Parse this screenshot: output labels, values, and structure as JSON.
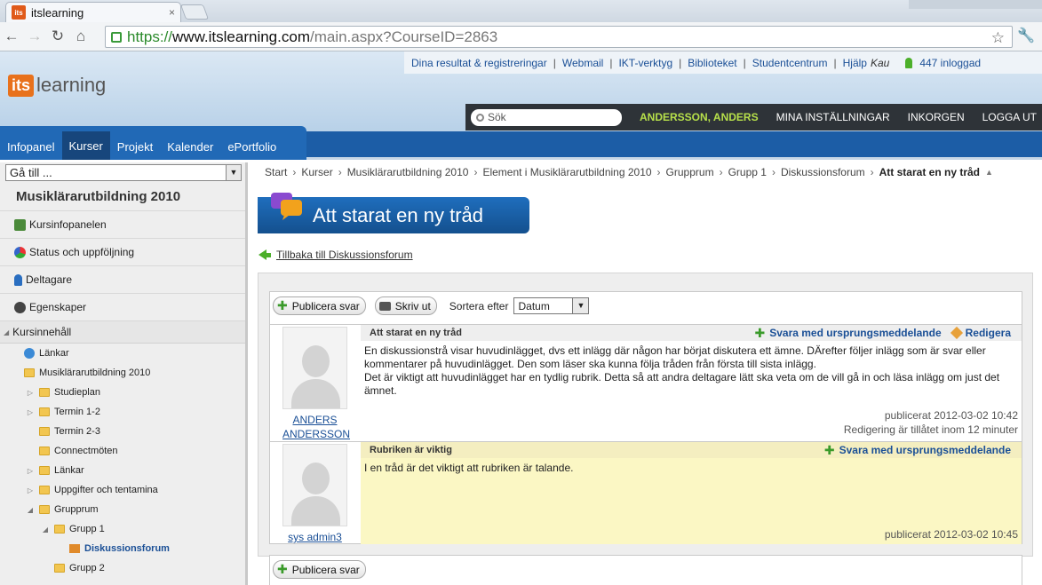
{
  "browser": {
    "tab_title": "itslearning",
    "tab_icon_text": "its",
    "tab_close": "×",
    "url_scheme": "https://",
    "url_host": "www.itslearning.com",
    "url_path": "/main.aspx?CourseID=2863"
  },
  "site": {
    "logo_its": "its",
    "logo_learning": "learning",
    "top_links": [
      "Dina resultat & registreringar",
      "Webmail",
      "IKT-verktyg",
      "Biblioteket",
      "Studentcentrum",
      "Hjälp"
    ],
    "separator": "|",
    "institution": "Kau",
    "online_count": "447 inloggad",
    "search_placeholder": "Sök",
    "user_name": "ANDERSSON, ANDERS",
    "settings_label": "MINA INSTÄLLNINGAR",
    "inbox_label": "INKORGEN",
    "logout_label": "LOGGA UT"
  },
  "nav": {
    "items": [
      "Infopanel",
      "Kurser",
      "Projekt",
      "Kalender",
      "ePortfolio"
    ],
    "active": "Kurser"
  },
  "sidebar": {
    "goto": "Gå till ...",
    "course_title": "Musiklärarutbildning 2010",
    "items": [
      {
        "label": "Kursinfopanelen",
        "icon": "info-board-icon"
      },
      {
        "label": "Status och uppföljning",
        "icon": "pie-chart-icon"
      },
      {
        "label": "Deltagare",
        "icon": "person-icon"
      },
      {
        "label": "Egenskaper",
        "icon": "gear-icon"
      }
    ],
    "content_header": "Kursinnehåll",
    "tree": [
      {
        "label": "Länkar",
        "indent": 0,
        "icon": "globe",
        "toggle": ""
      },
      {
        "label": "Musiklärarutbildning 2010",
        "indent": 0,
        "icon": "folder",
        "toggle": ""
      },
      {
        "label": "Studieplan",
        "indent": 1,
        "icon": "folder",
        "toggle": "▷"
      },
      {
        "label": "Termin 1-2",
        "indent": 1,
        "icon": "folder",
        "toggle": "▷"
      },
      {
        "label": "Termin 2-3",
        "indent": 1,
        "icon": "folder",
        "toggle": ""
      },
      {
        "label": "Connectmöten",
        "indent": 1,
        "icon": "folder",
        "toggle": ""
      },
      {
        "label": "Länkar",
        "indent": 1,
        "icon": "folder",
        "toggle": "▷"
      },
      {
        "label": "Uppgifter och tentamina",
        "indent": 1,
        "icon": "folder",
        "toggle": "▷"
      },
      {
        "label": "Grupprum",
        "indent": 1,
        "icon": "folder",
        "toggle": "◢"
      },
      {
        "label": "Grupp 1",
        "indent": 2,
        "icon": "folder",
        "toggle": "◢"
      },
      {
        "label": "Diskussionsforum",
        "indent": 3,
        "icon": "forum",
        "toggle": "",
        "current": true
      },
      {
        "label": "Grupp 2",
        "indent": 2,
        "icon": "folder",
        "toggle": ""
      }
    ]
  },
  "breadcrumb": [
    "Start",
    "Kurser",
    "Musiklärarutbildning 2010",
    "Element i Musiklärarutbildning 2010",
    "Grupprum",
    "Grupp 1",
    "Diskussionsforum",
    "Att starat en ny tråd"
  ],
  "breadcrumb_sep": "›",
  "page": {
    "title": "Att starat en ny tråd",
    "back_link": "Tillbaka till Diskussionsforum",
    "publish_label": "Publicera svar",
    "print_label": "Skriv ut",
    "sort_label": "Sortera efter",
    "sort_value": "Datum"
  },
  "posts": [
    {
      "author_line1": "ANDERS",
      "author_line2": "ANDERSSON",
      "subject": "Att starat en ny tråd",
      "reply_label": "Svara med ursprungsmeddelande",
      "edit_label": "Redigera",
      "body": "En diskussionstrå visar huvudinlägget, dvs ett inlägg där någon har börjat diskutera ett ämne. DÄrefter följer inlägg som är svar eller kommentarer på huvudinlägget. Den som läser ska kunna följa tråden från första till sista inlägg.\nDet är viktigt att huvudinlägget har en tydlig rubrik. Detta så att andra deltagare lätt ska veta om de vill gå in och läsa inlägg om just det ämnet.",
      "published": "publicerat 2012-03-02 10:42",
      "edit_note": "Redigering är tillåtet inom 12 minuter"
    },
    {
      "author_line1": "sys admin3",
      "subject": "Rubriken är viktig",
      "reply_label": "Svara med ursprungsmeddelande",
      "body": "I en tråd är det viktigt att rubriken är talande.",
      "published": "publicerat 2012-03-02 10:45"
    }
  ]
}
